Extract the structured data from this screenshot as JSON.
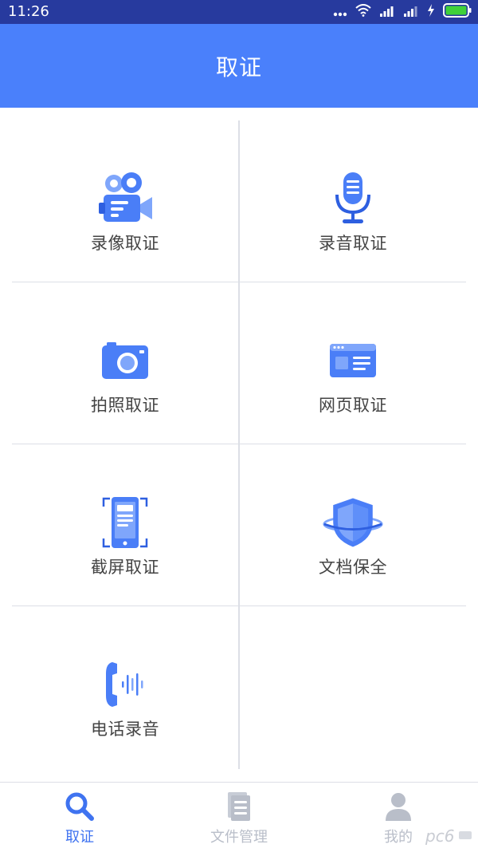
{
  "status_bar": {
    "time": "11:26",
    "icons": [
      "more-dots-icon",
      "wifi-icon",
      "signal-icon",
      "signal-icon",
      "charging-icon",
      "battery-icon"
    ]
  },
  "header": {
    "title": "取证"
  },
  "tiles": [
    {
      "label": "录像取证",
      "icon": "video-camera-icon"
    },
    {
      "label": "录音取证",
      "icon": "microphone-icon"
    },
    {
      "label": "拍照取证",
      "icon": "camera-icon"
    },
    {
      "label": "网页取证",
      "icon": "webpage-icon"
    },
    {
      "label": "截屏取证",
      "icon": "screenshot-phone-icon"
    },
    {
      "label": "文档保全",
      "icon": "shield-icon"
    },
    {
      "label": "电话录音",
      "icon": "phone-call-icon"
    }
  ],
  "tabbar": {
    "tabs": [
      {
        "label": "取证",
        "icon": "search-icon",
        "active": true
      },
      {
        "label": "文件管理",
        "icon": "document-icon",
        "active": false
      },
      {
        "label": "我的",
        "icon": "user-icon",
        "active": false
      }
    ]
  },
  "colors": {
    "status_bar": "#273a9e",
    "header": "#4a80fb",
    "accent": "#3f73f0",
    "icon_blue": "#4a7ef7",
    "inactive": "#b9bec9",
    "divider": "#dcdfe6"
  },
  "watermark": "pc6"
}
